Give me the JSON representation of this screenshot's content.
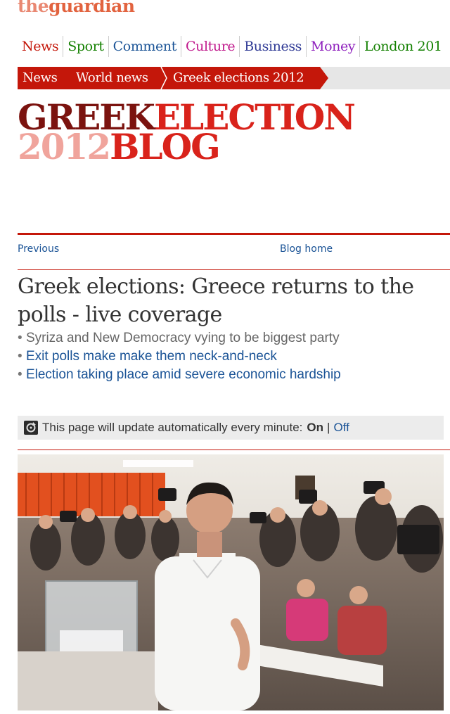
{
  "masthead": {
    "the": "the",
    "guardian": "guardian"
  },
  "nav": [
    {
      "label": "News",
      "color": "#c4170a"
    },
    {
      "label": "Sport",
      "color": "#138000"
    },
    {
      "label": "Comment",
      "color": "#1a5396"
    },
    {
      "label": "Culture",
      "color": "#c0198c"
    },
    {
      "label": "Business",
      "color": "#2f3a95"
    },
    {
      "label": "Money",
      "color": "#8e1fbd"
    },
    {
      "label": "London 201",
      "color": "#138000"
    }
  ],
  "breadcrumb": [
    "News",
    "World news",
    "Greek elections 2012"
  ],
  "blog_title": {
    "greek": "GREEK",
    "election": "ELECTION",
    "year": "2012",
    "blog": "BLOG"
  },
  "article_nav": {
    "previous": "Previous",
    "blog_home": "Blog home"
  },
  "headline": "Greek elections: Greece returns to the polls - live coverage",
  "standfirst": [
    {
      "text": "Syriza and New Democracy vying to be biggest party",
      "color": "#666666"
    },
    {
      "text": "Exit polls make make them neck-and-neck",
      "color": "#1a5396"
    },
    {
      "text": "Election taking place amid severe economic hardship",
      "color": "#1a5396"
    }
  ],
  "auto_update": {
    "message": "This page will update automatically every minute:",
    "on": "On",
    "separator": "|",
    "off": "Off",
    "icon": "refresh-icon"
  },
  "photo": {
    "icon": "news-photo"
  }
}
